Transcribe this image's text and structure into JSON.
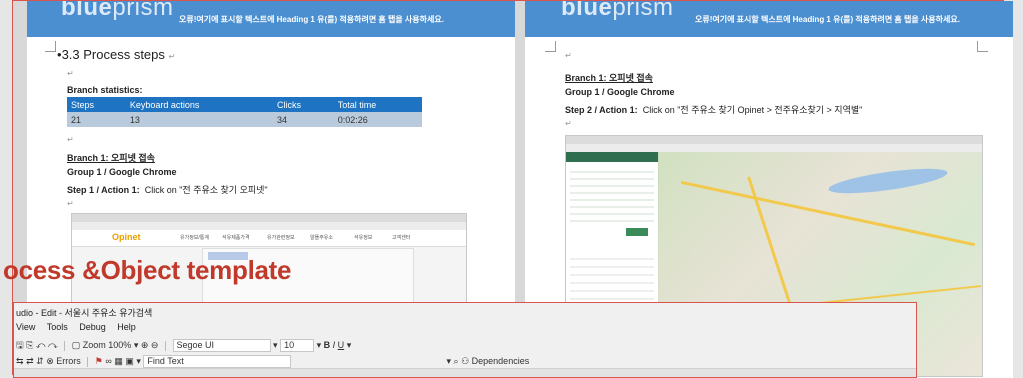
{
  "header": {
    "logo_prefix": "blue",
    "logo_suffix": "prism",
    "message": "오류!여기에 표시할 텍스트에 Heading 1 유(를) 적용하려면 홈 탭을 사용하세요."
  },
  "left_page": {
    "section_title": "3.3   Process steps",
    "branch_stats_label": "Branch statistics:",
    "table": {
      "headers": [
        "Steps",
        "Keyboard actions",
        "Clicks",
        "Total time"
      ],
      "rows": [
        [
          "21",
          "13",
          "34",
          "0:02:26"
        ]
      ]
    },
    "branch_title": "Branch 1: 오피넷 접속",
    "group_label": "Group 1 / Google Chrome",
    "step_prefix": "Step 1 / Action 1:",
    "step_text": "Click on \"전 주유소 찾기 오피넷\"",
    "screenshot": {
      "logo": "Opinet",
      "nav": [
        "유가정보/통계",
        "석유제품가격",
        "유가관련정보",
        "알뜰주유소",
        "석유정보",
        "고객센터"
      ]
    }
  },
  "right_page": {
    "branch_title": "Branch 1: 오피넷 접속",
    "group_label": "Group 1 / Google Chrome",
    "step_prefix": "Step 2 / Action 1:",
    "step_text": "Click on \"전 주유소 찾기 Opinet > 전주유소찾기 > 지역별\""
  },
  "overlay_title": "ocess &Object template",
  "studio": {
    "title": "udio - Edit - 서울시 주유소 유가검색",
    "menu": [
      "View",
      "Tools",
      "Debug",
      "Help"
    ],
    "zoom_label": "Zoom",
    "zoom_value": "100%",
    "font_name": "Segoe UI",
    "font_size": "10",
    "bold": "B",
    "italic": "I",
    "underline": "U",
    "errors_label": "Errors",
    "find_text_label": "Find Text",
    "dependencies_label": "Dependencies"
  },
  "colors": {
    "header_blue": "#4b8fd0",
    "table_header": "#1e74c2",
    "table_row": "#b8cadb",
    "overlay_red": "#c0392b",
    "frame_red": "#d9534f"
  }
}
